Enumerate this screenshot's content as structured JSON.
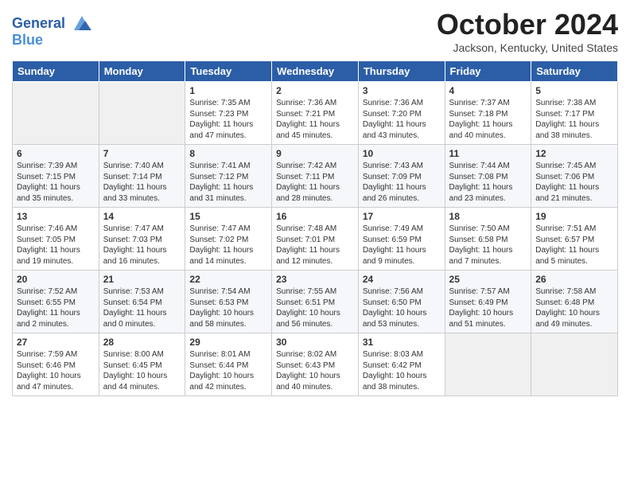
{
  "header": {
    "logo_line1": "General",
    "logo_line2": "Blue",
    "title": "October 2024",
    "location": "Jackson, Kentucky, United States"
  },
  "days_of_week": [
    "Sunday",
    "Monday",
    "Tuesday",
    "Wednesday",
    "Thursday",
    "Friday",
    "Saturday"
  ],
  "weeks": [
    [
      {
        "num": "",
        "empty": true
      },
      {
        "num": "",
        "empty": true
      },
      {
        "num": "1",
        "sunrise": "Sunrise: 7:35 AM",
        "sunset": "Sunset: 7:23 PM",
        "daylight": "Daylight: 11 hours and 47 minutes."
      },
      {
        "num": "2",
        "sunrise": "Sunrise: 7:36 AM",
        "sunset": "Sunset: 7:21 PM",
        "daylight": "Daylight: 11 hours and 45 minutes."
      },
      {
        "num": "3",
        "sunrise": "Sunrise: 7:36 AM",
        "sunset": "Sunset: 7:20 PM",
        "daylight": "Daylight: 11 hours and 43 minutes."
      },
      {
        "num": "4",
        "sunrise": "Sunrise: 7:37 AM",
        "sunset": "Sunset: 7:18 PM",
        "daylight": "Daylight: 11 hours and 40 minutes."
      },
      {
        "num": "5",
        "sunrise": "Sunrise: 7:38 AM",
        "sunset": "Sunset: 7:17 PM",
        "daylight": "Daylight: 11 hours and 38 minutes."
      }
    ],
    [
      {
        "num": "6",
        "sunrise": "Sunrise: 7:39 AM",
        "sunset": "Sunset: 7:15 PM",
        "daylight": "Daylight: 11 hours and 35 minutes."
      },
      {
        "num": "7",
        "sunrise": "Sunrise: 7:40 AM",
        "sunset": "Sunset: 7:14 PM",
        "daylight": "Daylight: 11 hours and 33 minutes."
      },
      {
        "num": "8",
        "sunrise": "Sunrise: 7:41 AM",
        "sunset": "Sunset: 7:12 PM",
        "daylight": "Daylight: 11 hours and 31 minutes."
      },
      {
        "num": "9",
        "sunrise": "Sunrise: 7:42 AM",
        "sunset": "Sunset: 7:11 PM",
        "daylight": "Daylight: 11 hours and 28 minutes."
      },
      {
        "num": "10",
        "sunrise": "Sunrise: 7:43 AM",
        "sunset": "Sunset: 7:09 PM",
        "daylight": "Daylight: 11 hours and 26 minutes."
      },
      {
        "num": "11",
        "sunrise": "Sunrise: 7:44 AM",
        "sunset": "Sunset: 7:08 PM",
        "daylight": "Daylight: 11 hours and 23 minutes."
      },
      {
        "num": "12",
        "sunrise": "Sunrise: 7:45 AM",
        "sunset": "Sunset: 7:06 PM",
        "daylight": "Daylight: 11 hours and 21 minutes."
      }
    ],
    [
      {
        "num": "13",
        "sunrise": "Sunrise: 7:46 AM",
        "sunset": "Sunset: 7:05 PM",
        "daylight": "Daylight: 11 hours and 19 minutes."
      },
      {
        "num": "14",
        "sunrise": "Sunrise: 7:47 AM",
        "sunset": "Sunset: 7:03 PM",
        "daylight": "Daylight: 11 hours and 16 minutes."
      },
      {
        "num": "15",
        "sunrise": "Sunrise: 7:47 AM",
        "sunset": "Sunset: 7:02 PM",
        "daylight": "Daylight: 11 hours and 14 minutes."
      },
      {
        "num": "16",
        "sunrise": "Sunrise: 7:48 AM",
        "sunset": "Sunset: 7:01 PM",
        "daylight": "Daylight: 11 hours and 12 minutes."
      },
      {
        "num": "17",
        "sunrise": "Sunrise: 7:49 AM",
        "sunset": "Sunset: 6:59 PM",
        "daylight": "Daylight: 11 hours and 9 minutes."
      },
      {
        "num": "18",
        "sunrise": "Sunrise: 7:50 AM",
        "sunset": "Sunset: 6:58 PM",
        "daylight": "Daylight: 11 hours and 7 minutes."
      },
      {
        "num": "19",
        "sunrise": "Sunrise: 7:51 AM",
        "sunset": "Sunset: 6:57 PM",
        "daylight": "Daylight: 11 hours and 5 minutes."
      }
    ],
    [
      {
        "num": "20",
        "sunrise": "Sunrise: 7:52 AM",
        "sunset": "Sunset: 6:55 PM",
        "daylight": "Daylight: 11 hours and 2 minutes."
      },
      {
        "num": "21",
        "sunrise": "Sunrise: 7:53 AM",
        "sunset": "Sunset: 6:54 PM",
        "daylight": "Daylight: 11 hours and 0 minutes."
      },
      {
        "num": "22",
        "sunrise": "Sunrise: 7:54 AM",
        "sunset": "Sunset: 6:53 PM",
        "daylight": "Daylight: 10 hours and 58 minutes."
      },
      {
        "num": "23",
        "sunrise": "Sunrise: 7:55 AM",
        "sunset": "Sunset: 6:51 PM",
        "daylight": "Daylight: 10 hours and 56 minutes."
      },
      {
        "num": "24",
        "sunrise": "Sunrise: 7:56 AM",
        "sunset": "Sunset: 6:50 PM",
        "daylight": "Daylight: 10 hours and 53 minutes."
      },
      {
        "num": "25",
        "sunrise": "Sunrise: 7:57 AM",
        "sunset": "Sunset: 6:49 PM",
        "daylight": "Daylight: 10 hours and 51 minutes."
      },
      {
        "num": "26",
        "sunrise": "Sunrise: 7:58 AM",
        "sunset": "Sunset: 6:48 PM",
        "daylight": "Daylight: 10 hours and 49 minutes."
      }
    ],
    [
      {
        "num": "27",
        "sunrise": "Sunrise: 7:59 AM",
        "sunset": "Sunset: 6:46 PM",
        "daylight": "Daylight: 10 hours and 47 minutes."
      },
      {
        "num": "28",
        "sunrise": "Sunrise: 8:00 AM",
        "sunset": "Sunset: 6:45 PM",
        "daylight": "Daylight: 10 hours and 44 minutes."
      },
      {
        "num": "29",
        "sunrise": "Sunrise: 8:01 AM",
        "sunset": "Sunset: 6:44 PM",
        "daylight": "Daylight: 10 hours and 42 minutes."
      },
      {
        "num": "30",
        "sunrise": "Sunrise: 8:02 AM",
        "sunset": "Sunset: 6:43 PM",
        "daylight": "Daylight: 10 hours and 40 minutes."
      },
      {
        "num": "31",
        "sunrise": "Sunrise: 8:03 AM",
        "sunset": "Sunset: 6:42 PM",
        "daylight": "Daylight: 10 hours and 38 minutes."
      },
      {
        "num": "",
        "empty": true
      },
      {
        "num": "",
        "empty": true
      }
    ]
  ]
}
